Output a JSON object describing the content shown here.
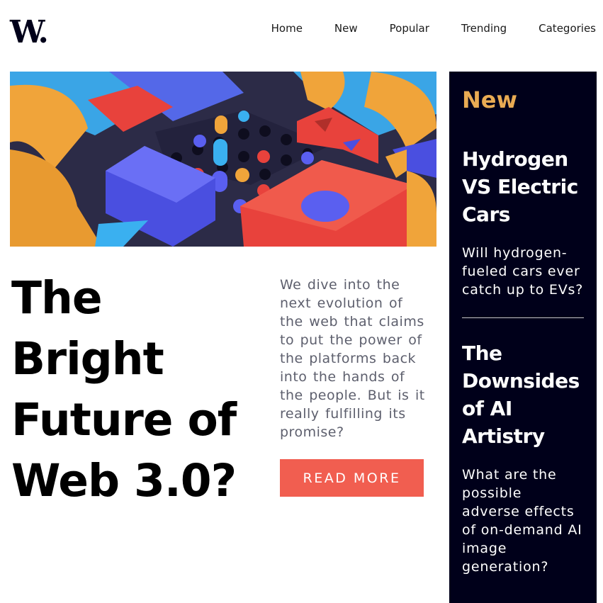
{
  "header": {
    "logo": "W.",
    "nav": [
      "Home",
      "New",
      "Popular",
      "Trending",
      "Categories"
    ]
  },
  "main": {
    "hero_image_alt": "abstract 3D blocks image",
    "headline": "The Bright Future of Web 3.0?",
    "excerpt": "We dive into the next evolution of the web that claims to put the power of the platforms back into the hands of the people. But is it really fulfilling its promise?",
    "read_more_label": "READ MORE"
  },
  "sidebar": {
    "title": "New",
    "articles": [
      {
        "title": "Hydrogen VS Electric Cars",
        "text": "Will hydrogen-fueled cars ever catch up to EVs?"
      },
      {
        "title": "The Downsides of AI Artistry",
        "text": "What are the possible adverse effects of on-demand AI image generation?"
      }
    ]
  },
  "colors": {
    "accent": "#f15e50",
    "sidebar_bg": "#00001a",
    "sidebar_title": "#e9ab53",
    "text_muted": "#5d5f6d"
  }
}
